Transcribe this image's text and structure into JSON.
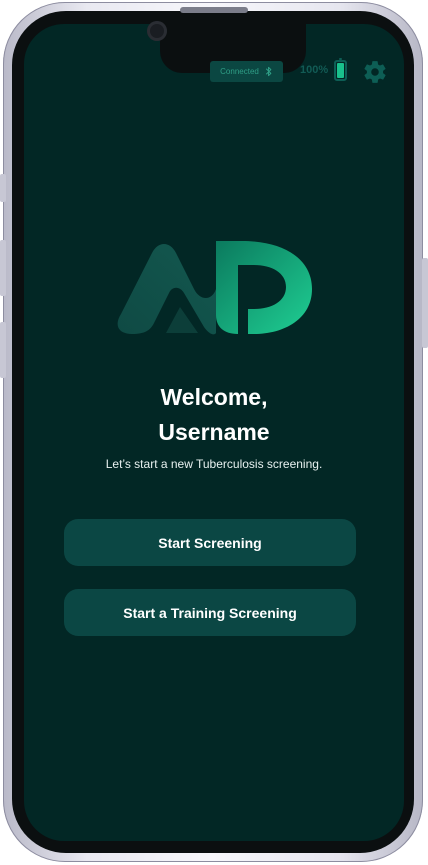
{
  "status_bar": {
    "connection_label": "Connected",
    "connection_icon": "bluetooth-icon",
    "battery_percent": "100%",
    "battery_level": 1.0,
    "settings_icon": "gear-icon"
  },
  "logo": {
    "icon": "ad-logo",
    "colors": {
      "dark": "#0f5a52",
      "accent": "#19c08c"
    }
  },
  "welcome": {
    "line1": "Welcome,",
    "line2": "Username",
    "subtitle": "Let’s start a new Tuberculosis screening."
  },
  "actions": {
    "start_screening": "Start Screening",
    "start_training": "Start a Training Screening"
  },
  "colors": {
    "background": "#022725",
    "button": "#0b4744",
    "accent": "#19c08c"
  }
}
